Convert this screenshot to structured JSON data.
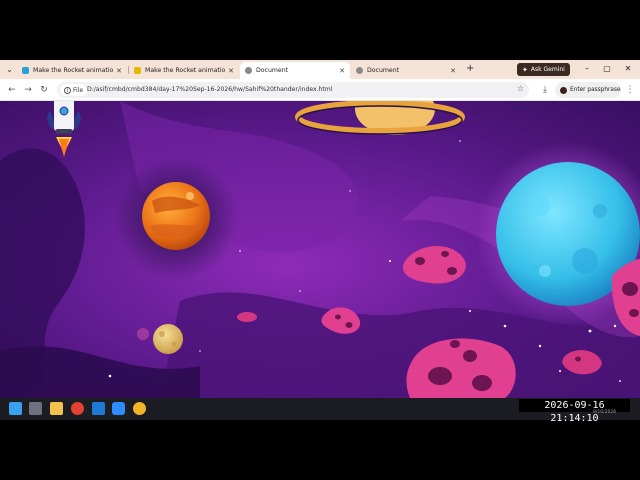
{
  "browser": {
    "tabs": [
      {
        "label": "Make the Rocket animation by",
        "favicon_color": "#2a9fd6",
        "active": false
      },
      {
        "label": "Make the Rocket animation by",
        "favicon_color": "#e6b800",
        "active": false
      },
      {
        "label": "Document",
        "favicon_color": "#8a8a8a",
        "active": true
      },
      {
        "label": "Document",
        "favicon_color": "#8a8a8a",
        "active": false
      }
    ],
    "new_tab_label": "+",
    "ask_gemini_label": "Ask Gemini",
    "address_chip_label": "File",
    "url": "D:/asif/cmbd/cmbd384/day-17%20Sep-16-2026/hw/Sahif%20thander/index.html",
    "passphrase_label": "Enter passphrase"
  },
  "page": {
    "scene": "space-rocket-animation",
    "colors": {
      "sky": "#6b1e9c",
      "planet_orange": "#f08a1c",
      "planet_blue": "#39c6f0",
      "asteroid": "#e0408f",
      "saturn_ring": "#e8a33c"
    }
  },
  "taskbar": {
    "clock": "2026-09-16  21:14:10",
    "tray_date": "9/16/2026"
  }
}
